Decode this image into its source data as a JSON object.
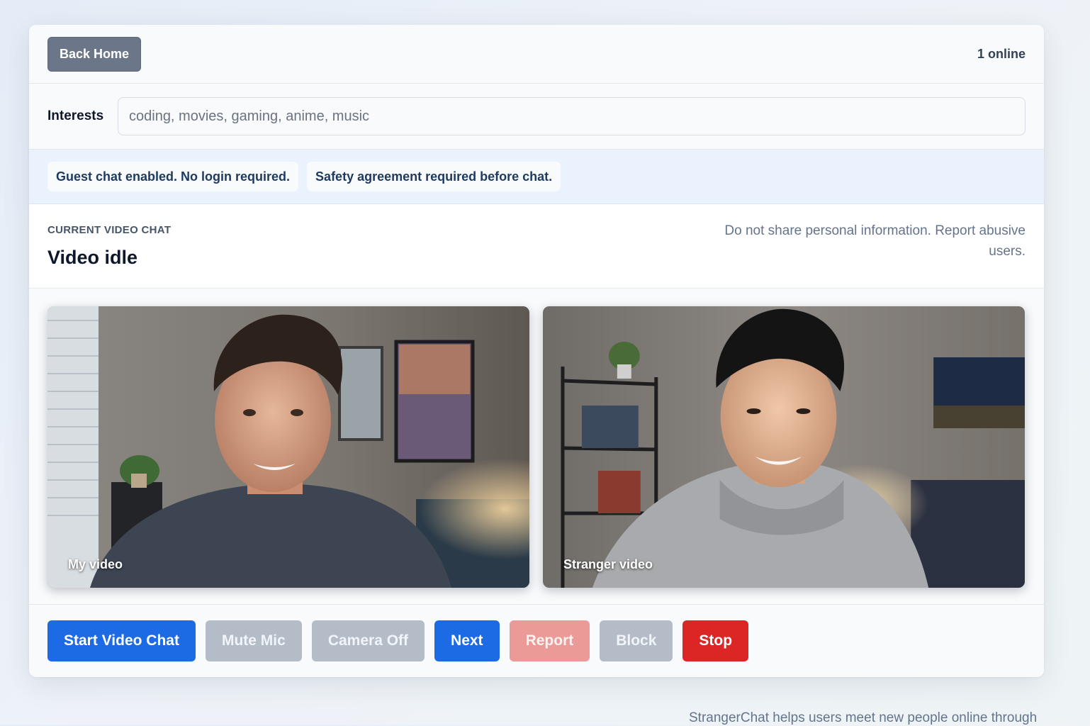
{
  "header": {
    "back_label": "Back Home",
    "online_text": "1 online"
  },
  "interests": {
    "label": "Interests",
    "placeholder": "coding, movies, gaming, anime, music",
    "value": ""
  },
  "notices": [
    "Guest chat enabled. No login required.",
    "Safety agreement required before chat."
  ],
  "chat": {
    "eyebrow": "CURRENT VIDEO CHAT",
    "status": "Video idle",
    "warning": "Do not share personal information. Report abusive users."
  },
  "videos": {
    "mine_label": "My video",
    "stranger_label": "Stranger video"
  },
  "controls": {
    "start": "Start Video Chat",
    "mute": "Mute Mic",
    "camera": "Camera Off",
    "next": "Next",
    "report": "Report",
    "block": "Block",
    "stop": "Stop"
  },
  "footer": {
    "text": "StrangerChat helps users meet new people online through"
  },
  "colors": {
    "primary": "#1d6ae5",
    "danger": "#dc2626",
    "report": "#eb9a98",
    "disabled": "#b4bcc8",
    "back_button": "#6b7789"
  }
}
